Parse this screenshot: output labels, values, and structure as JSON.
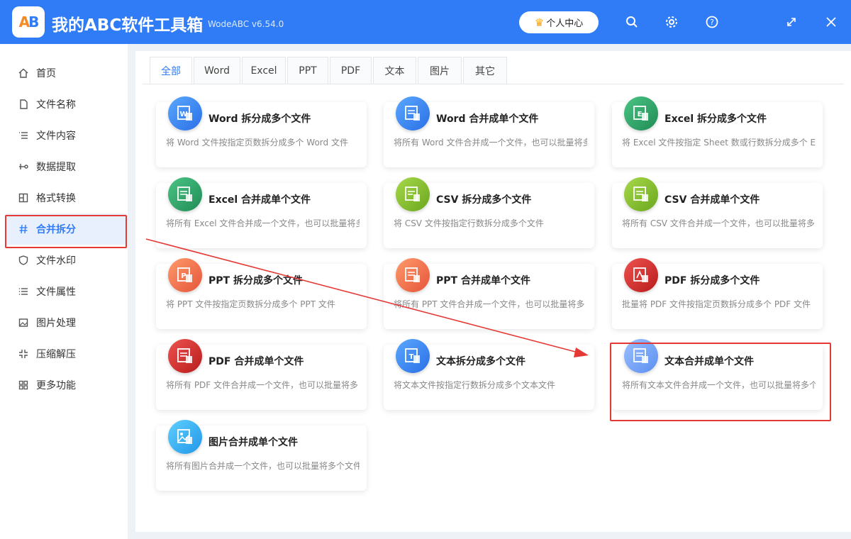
{
  "app": {
    "title": "我的ABC软件工具箱",
    "version": "WodeABC v6.54.0",
    "logo_text_a": "A",
    "logo_text_b": "B",
    "user_center": "个人中心"
  },
  "sidebar": {
    "items": [
      {
        "label": "首页",
        "icon": "home-icon"
      },
      {
        "label": "文件名称",
        "icon": "file-icon"
      },
      {
        "label": "文件内容",
        "icon": "list-icon"
      },
      {
        "label": "数据提取",
        "icon": "extract-icon"
      },
      {
        "label": "格式转换",
        "icon": "convert-icon"
      },
      {
        "label": "合并拆分",
        "icon": "hash-icon"
      },
      {
        "label": "文件水印",
        "icon": "shield-icon"
      },
      {
        "label": "文件属性",
        "icon": "properties-icon"
      },
      {
        "label": "图片处理",
        "icon": "image-icon"
      },
      {
        "label": "压缩解压",
        "icon": "compress-icon"
      },
      {
        "label": "更多功能",
        "icon": "grid-icon"
      }
    ],
    "active_index": 5
  },
  "tabs": [
    {
      "label": "全部"
    },
    {
      "label": "Word"
    },
    {
      "label": "Excel"
    },
    {
      "label": "PPT"
    },
    {
      "label": "PDF"
    },
    {
      "label": "文本"
    },
    {
      "label": "图片"
    },
    {
      "label": "其它"
    }
  ],
  "cards": [
    {
      "title": "Word 拆分成多个文件",
      "desc": "将 Word 文件按指定页数拆分成多个 Word 文件",
      "icon": "word-icon"
    },
    {
      "title": "Word 合并成单个文件",
      "desc": "将所有 Word 文件合并成一个文件，也可以批量将多",
      "icon": "word-merge-icon"
    },
    {
      "title": "Excel 拆分成多个文件",
      "desc": "将 Excel 文件按指定 Sheet 数或行数拆分成多个 Exc",
      "icon": "excel-icon"
    },
    {
      "title": "Excel 合并成单个文件",
      "desc": "将所有 Excel 文件合并成一个文件，也可以批量将多",
      "icon": "excel-merge-icon"
    },
    {
      "title": "CSV 拆分成多个文件",
      "desc": "将 CSV 文件按指定行数拆分成多个文件",
      "icon": "csv-icon"
    },
    {
      "title": "CSV 合并成单个文件",
      "desc": "将所有 CSV 文件合并成一个文件，也可以批量将多",
      "icon": "csv-merge-icon"
    },
    {
      "title": "PPT 拆分成多个文件",
      "desc": "将 PPT 文件按指定页数拆分成多个 PPT 文件",
      "icon": "ppt-icon"
    },
    {
      "title": "PPT 合并成单个文件",
      "desc": "将所有 PPT 文件合并成一个文件，也可以批量将多",
      "icon": "ppt-merge-icon"
    },
    {
      "title": "PDF 拆分成多个文件",
      "desc": "批量将 PDF 文件按指定页数拆分成多个 PDF 文件",
      "icon": "pdf-icon"
    },
    {
      "title": "PDF 合并成单个文件",
      "desc": "将所有 PDF 文件合并成一个文件，也可以批量将多",
      "icon": "pdf-merge-icon"
    },
    {
      "title": "文本拆分成多个文件",
      "desc": "将文本文件按指定行数拆分成多个文本文件",
      "icon": "text-icon"
    },
    {
      "title": "文本合并成单个文件",
      "desc": "将所有文本文件合并成一个文件，也可以批量将多个",
      "icon": "text-merge-icon"
    },
    {
      "title": "图片合并成单个文件",
      "desc": "将所有图片合并成一个文件，也可以批量将多个文件",
      "icon": "image-merge-icon"
    }
  ],
  "colors": {
    "accent": "#2f7cf6",
    "highlight": "#e53935"
  }
}
